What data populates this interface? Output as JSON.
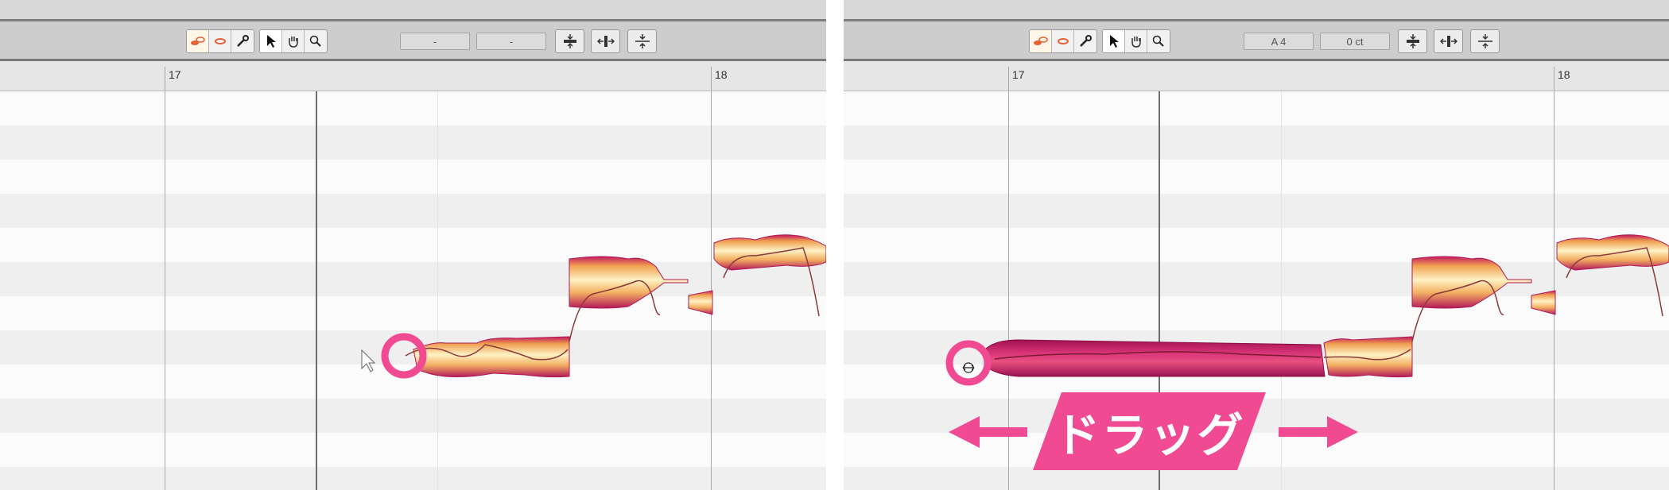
{
  "left": {
    "ruler": {
      "bar_17": "17",
      "bar_18": "18"
    },
    "pitch_field": "-",
    "cents_field": "-"
  },
  "right": {
    "ruler": {
      "bar_17": "17",
      "bar_18": "18"
    },
    "pitch_field": "A 4",
    "cents_field": "0 ct"
  },
  "annotation": {
    "label": "ドラッグ",
    "highlight_color": "#f04a93"
  },
  "icons": {
    "tools": [
      "pitch-tool-icon",
      "formant-tool-icon",
      "wrench-icon",
      "pointer-icon",
      "hand-icon",
      "magnifier-icon"
    ],
    "actions": [
      "center-pitch-icon",
      "separation-icon",
      "quantize-icon"
    ]
  }
}
